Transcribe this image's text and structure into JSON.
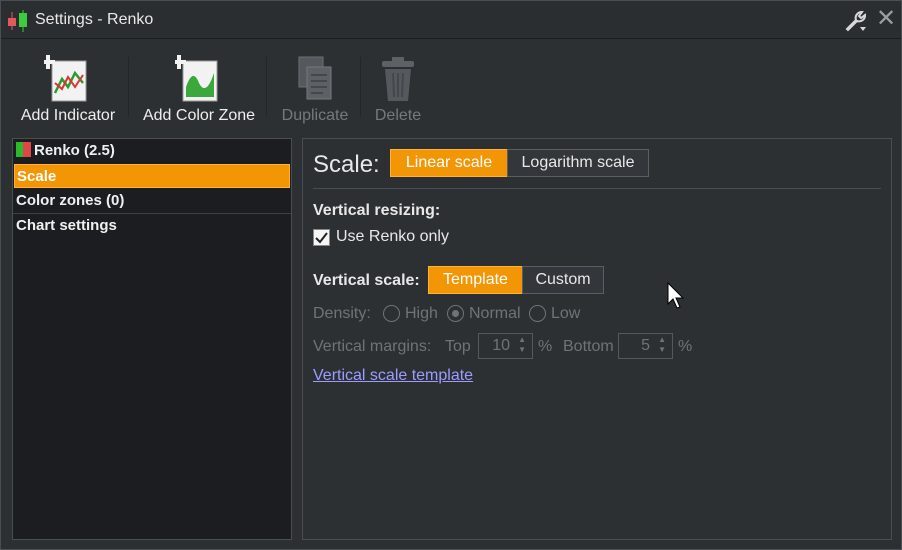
{
  "window": {
    "title": "Settings - Renko"
  },
  "toolbar": {
    "add_indicator": "Add Indicator",
    "add_color_zone": "Add Color Zone",
    "duplicate": "Duplicate",
    "delete": "Delete"
  },
  "tree": {
    "items": [
      {
        "label": "Renko (2.5)"
      },
      {
        "label": "Scale"
      },
      {
        "label": "Color zones (0)"
      },
      {
        "label": "Chart settings"
      }
    ]
  },
  "scale": {
    "label": "Scale:",
    "options": [
      "Linear scale",
      "Logarithm scale"
    ],
    "selected": "Linear scale",
    "vertical_resizing_label": "Vertical resizing:",
    "use_renko_only": "Use Renko only",
    "use_renko_only_checked": true,
    "vertical_scale_label": "Vertical scale:",
    "vertical_scale_options": [
      "Template",
      "Custom"
    ],
    "vertical_scale_selected": "Template",
    "density_label": "Density:",
    "density_options": [
      "High",
      "Normal",
      "Low"
    ],
    "density_selected": "Normal",
    "margins_label": "Vertical margins:",
    "top_label": "Top",
    "top_value": "10",
    "bottom_label": "Bottom",
    "bottom_value": "5",
    "percent": "%",
    "template_link": "Vertical scale template"
  },
  "colors": {
    "accent": "#f39606",
    "link": "#9c9cff",
    "background": "#2d3033"
  }
}
